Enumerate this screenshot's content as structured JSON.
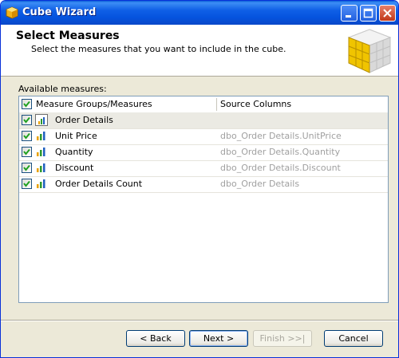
{
  "window": {
    "title": "Cube Wizard"
  },
  "header": {
    "title": "Select Measures",
    "subtitle": "Select the measures that you want to include in the cube."
  },
  "measures": {
    "label": "Available measures:",
    "columns": [
      "Measure Groups/Measures",
      "Source Columns"
    ],
    "group": {
      "name": "Order Details",
      "checked": true
    },
    "rows": [
      {
        "name": "Unit Price",
        "source": "dbo_Order Details.UnitPrice",
        "checked": true
      },
      {
        "name": "Quantity",
        "source": "dbo_Order Details.Quantity",
        "checked": true
      },
      {
        "name": "Discount",
        "source": "dbo_Order Details.Discount",
        "checked": true
      },
      {
        "name": "Order Details Count",
        "source": "dbo_Order Details",
        "checked": true
      }
    ]
  },
  "buttons": {
    "back": "< Back",
    "next": "Next >",
    "finish": "Finish >>|",
    "cancel": "Cancel"
  }
}
